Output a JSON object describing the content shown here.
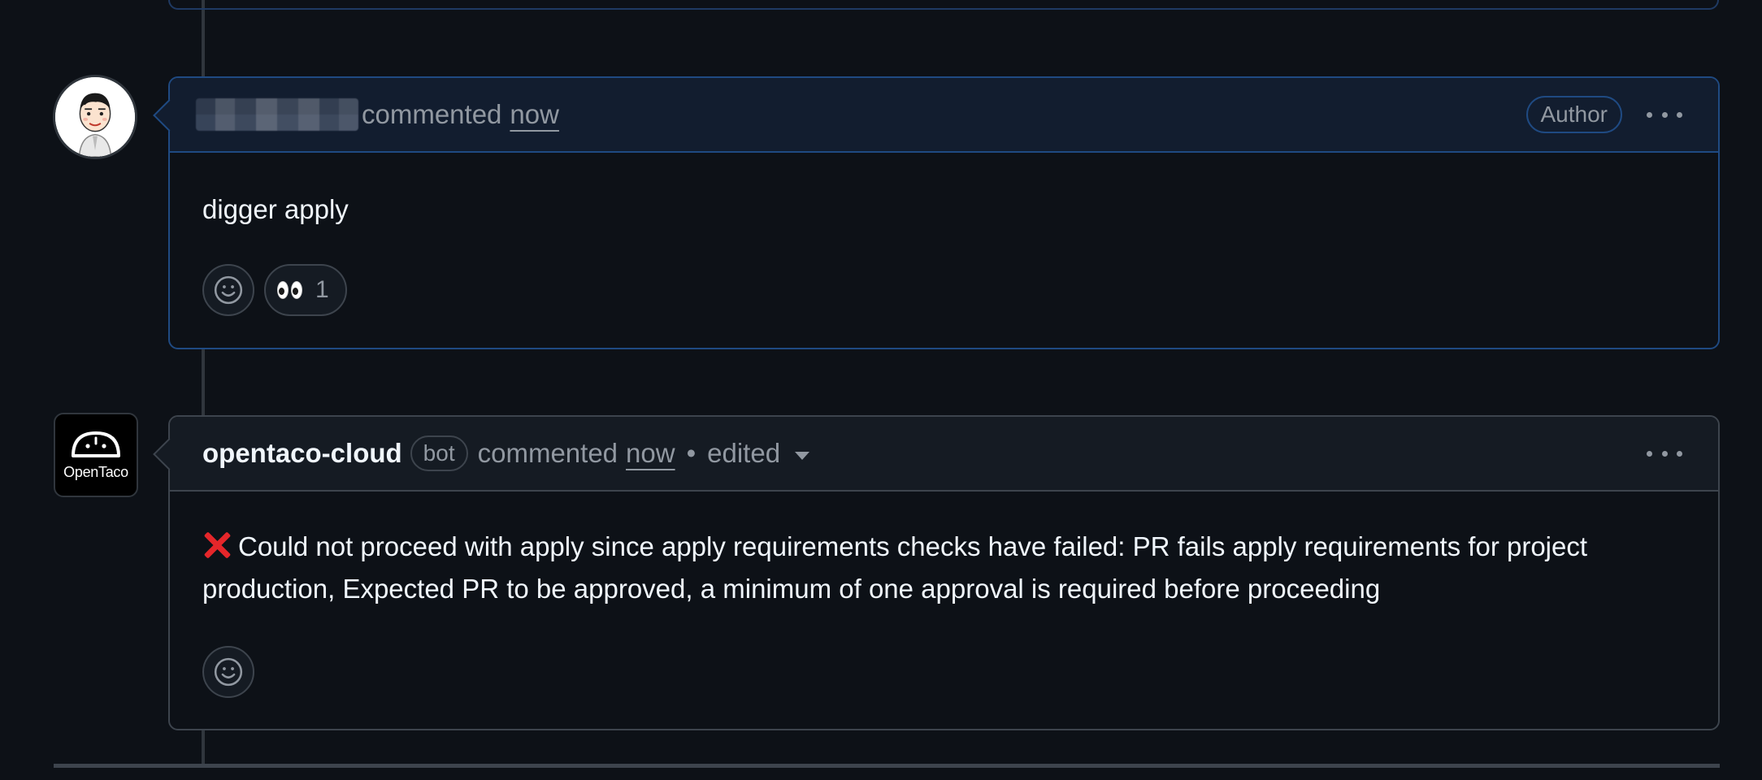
{
  "comment_1": {
    "verb": "commented",
    "time": "now",
    "badge": "Author",
    "body": "digger apply",
    "reaction": {
      "emoji_name": "eyes-icon",
      "count": "1"
    }
  },
  "comment_2": {
    "author": "opentaco-cloud",
    "badge": "bot",
    "verb": "commented",
    "time": "now",
    "separator": "•",
    "edited": "edited",
    "avatar_text": "OpenTaco",
    "status_icon": "cross-mark-icon",
    "body": "Could not proceed with apply since apply requirements checks have failed: PR fails apply requirements for project production, Expected PR to be approved, a minimum of one approval is required before proceeding"
  },
  "colors": {
    "background": "#0d1117",
    "author_border": "#1f4a82",
    "error_red": "#e5262a"
  }
}
